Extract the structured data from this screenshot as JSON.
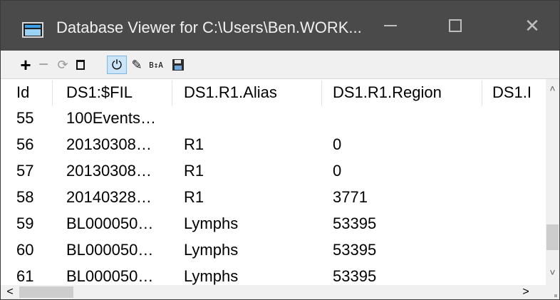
{
  "window": {
    "title": "Database Viewer for C:\\Users\\Ben.WORK...",
    "titlebar_color": "#4a4a4a"
  },
  "toolbar": {
    "add": "+",
    "remove": "−",
    "refresh": "⟳",
    "power": "⏻",
    "pencil": "✎",
    "sort": "B↕A",
    "buttons": [
      "plus-icon",
      "minus-icon",
      "refresh-icon",
      "trash-icon",
      "power-icon",
      "pencil-icon",
      "sort-icon",
      "save-icon"
    ]
  },
  "table": {
    "columns": [
      "Id",
      "DS1:$FIL",
      "DS1.R1.Alias",
      "DS1.R1.Region",
      "DS1.I"
    ],
    "rows": [
      {
        "id": "55",
        "fil": "100Events…",
        "alias": "",
        "region": ""
      },
      {
        "id": "56",
        "fil": "20130308…",
        "alias": "R1",
        "region": "0"
      },
      {
        "id": "57",
        "fil": "20130308…",
        "alias": "R1",
        "region": "0"
      },
      {
        "id": "58",
        "fil": "20140328…",
        "alias": "R1",
        "region": "3771"
      },
      {
        "id": "59",
        "fil": "BL000050…",
        "alias": "Lymphs",
        "region": "53395"
      },
      {
        "id": "60",
        "fil": "BL000050…",
        "alias": "Lymphs",
        "region": "53395"
      },
      {
        "id": "61",
        "fil": "BL000050…",
        "alias": "Lymphs",
        "region": "53395"
      }
    ]
  },
  "scroll": {
    "up": "˄",
    "down": "˅",
    "left": "<",
    "right": ">"
  }
}
